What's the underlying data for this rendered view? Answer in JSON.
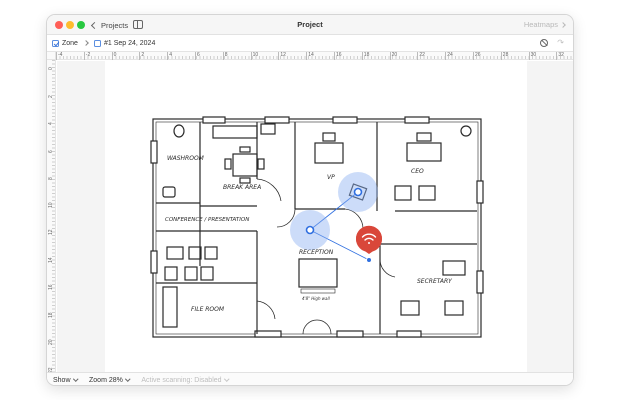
{
  "titlebar": {
    "back_label": "Projects",
    "title": "Project",
    "right_label": "Heatmaps"
  },
  "toolbar": {
    "zone_label": "Zone",
    "scan_label": "#1 Sep 24, 2024"
  },
  "ruler": {
    "h_ticks": [
      "-4",
      "-2",
      "0",
      "2",
      "4",
      "6",
      "8",
      "10",
      "12",
      "14",
      "16",
      "18",
      "20",
      "22",
      "24",
      "26",
      "28",
      "30",
      "32"
    ],
    "v_ticks": [
      "0",
      "2",
      "4",
      "6",
      "8",
      "10",
      "12",
      "14",
      "16",
      "18",
      "20",
      "22"
    ]
  },
  "floorplan": {
    "rooms": [
      "WASHROOM",
      "BREAK AREA",
      "CONFERENCE / PRESENTATION",
      "FILE ROOM",
      "VP",
      "CEO",
      "RECEPTION",
      "SECRETARY"
    ],
    "reception_note": "4'8\" High wall",
    "access_point": {
      "icon": "wifi-icon",
      "color": "#d9473a"
    },
    "scan_color": "#2f6fe0"
  },
  "statusbar": {
    "show_label": "Show",
    "zoom_label": "Zoom 28%",
    "scanning_label": "Active scanning: Disabled"
  }
}
